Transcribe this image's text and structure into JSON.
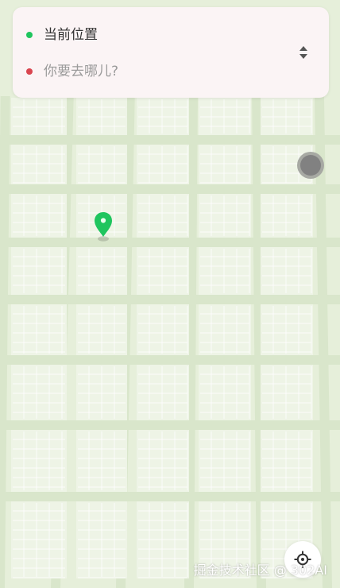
{
  "route_panel": {
    "origin_text": "当前位置",
    "destination_placeholder": "你要去哪儿?",
    "origin_dot_color": "#1fc55e",
    "destination_dot_color": "#d9454f",
    "swap_icon": "swap-vertical-icon"
  },
  "map": {
    "background_color": "#e6efda",
    "road_color": "#d9e6cb",
    "block_color": "#eef4e6",
    "grid_line_color": "#ffffff",
    "selected_pin_color": "#1fc55e",
    "selected_pin_icon": "map-pin-icon",
    "other_marker_icon": "gray-circle-marker-icon"
  },
  "controls": {
    "locate_icon": "crosshair-icon"
  },
  "watermark": {
    "text": "掘金技术社区 @ 302AI"
  }
}
